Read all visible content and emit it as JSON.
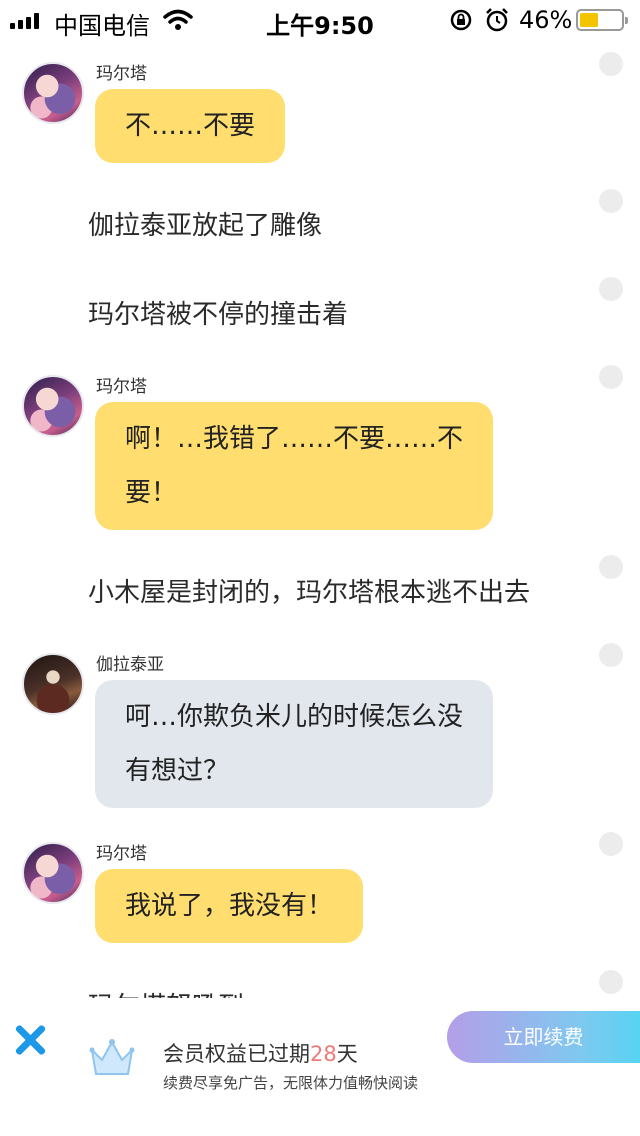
{
  "status_bar": {
    "carrier": "中国电信",
    "time": "上午9:50",
    "battery_percent": "46%",
    "battery_level": 0.46,
    "icons": [
      "signal-icon",
      "wifi-icon",
      "orientation-lock-icon",
      "alarm-icon",
      "battery-icon"
    ]
  },
  "feed": {
    "blocks": [
      {
        "kind": "dialogue",
        "speaker": "玛尔塔",
        "avatar": "marta-avatar",
        "bubble_color": "#ffdd6e",
        "lines": [
          "不……不要"
        ]
      },
      {
        "kind": "narration",
        "text": "伽拉泰亚放起了雕像"
      },
      {
        "kind": "narration",
        "text": "玛尔塔被不停的撞击着"
      },
      {
        "kind": "dialogue",
        "speaker": "玛尔塔",
        "avatar": "marta-avatar",
        "bubble_color": "#ffdd6e",
        "lines": [
          "啊！…我错了……不要……不",
          "要！"
        ]
      },
      {
        "kind": "narration",
        "text": "小木屋是封闭的，玛尔塔根本逃不出去"
      },
      {
        "kind": "dialogue",
        "speaker": "伽拉泰亚",
        "avatar": "galatea-avatar",
        "bubble_color": "#e2e7ee",
        "lines": [
          "呵…你欺负米儿的时候怎么没",
          "有想过？"
        ]
      },
      {
        "kind": "dialogue",
        "speaker": "玛尔塔",
        "avatar": "marta-avatar",
        "bubble_color": "#ffdd6e",
        "lines": [
          "我说了，我没有！"
        ]
      },
      {
        "kind": "narration",
        "text": "玛尔塔怒吼到"
      }
    ]
  },
  "banner": {
    "title_prefix": "会员权益已过期",
    "expired_days": "28",
    "title_suffix": "天",
    "subtitle": "续费尽享免广告，无限体力值畅快阅读",
    "renew_label": "立即续费",
    "accent_days_color": "#f07a7a",
    "close_icon": "close-icon",
    "crown_icon": "crown-icon"
  }
}
